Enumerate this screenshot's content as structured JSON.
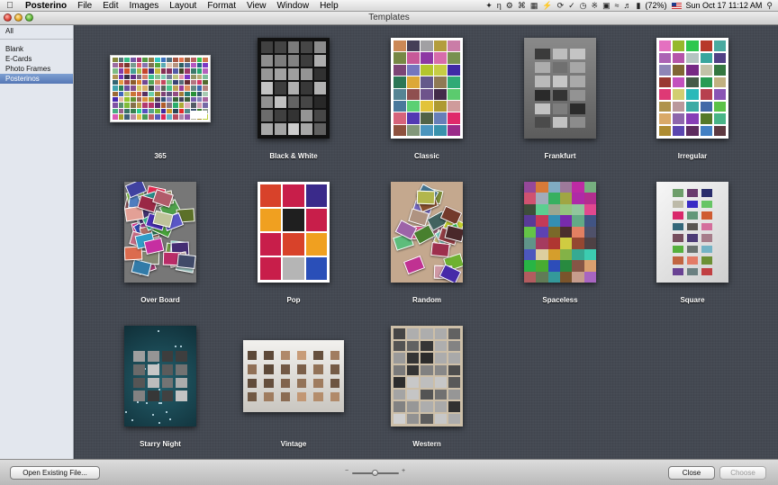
{
  "menubar": {
    "apple_icon": "apple-icon",
    "app_name": "Posterino",
    "menus": [
      "File",
      "Edit",
      "Images",
      "Layout",
      "Format",
      "View",
      "Window",
      "Help"
    ],
    "status": {
      "battery": "(72%)",
      "clock": "Sun Oct 17  11:12 AM"
    }
  },
  "window": {
    "title": "Templates"
  },
  "sidebar": {
    "all_label": "All",
    "items": [
      "Blank",
      "E-Cards",
      "Photo Frames",
      "Posterinos"
    ],
    "selected": "Posterinos"
  },
  "templates": [
    {
      "name": "365"
    },
    {
      "name": "Black & White"
    },
    {
      "name": "Classic"
    },
    {
      "name": "Frankfurt"
    },
    {
      "name": "Irregular"
    },
    {
      "name": "Over Board"
    },
    {
      "name": "Pop"
    },
    {
      "name": "Random"
    },
    {
      "name": "Spaceless"
    },
    {
      "name": "Square"
    },
    {
      "name": "Starry Night"
    },
    {
      "name": "Vintage"
    },
    {
      "name": "Western"
    }
  ],
  "bottombar": {
    "open_button": "Open Existing File...",
    "zoom_minus": "−",
    "zoom_plus": "+",
    "zoom_level": 0.5,
    "close_button": "Close",
    "choose_button": "Choose"
  },
  "colors": {
    "content_bg": "#444952",
    "sidebar_bg": "#e3e7ee",
    "selection": "#5577b5"
  }
}
